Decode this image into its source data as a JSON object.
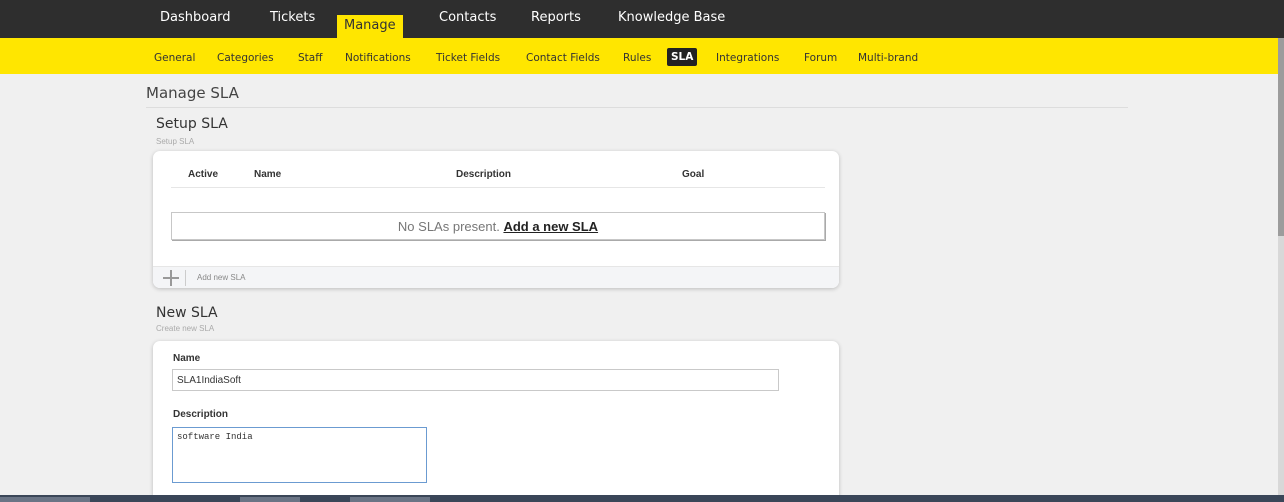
{
  "top_nav": {
    "items": [
      "Dashboard",
      "Tickets",
      "Manage",
      "Contacts",
      "Reports",
      "Knowledge Base"
    ],
    "active": "Manage"
  },
  "sub_nav": {
    "items": [
      "General",
      "Categories",
      "Staff",
      "Notifications",
      "Ticket Fields",
      "Contact Fields",
      "Rules",
      "SLA",
      "Integrations",
      "Forum",
      "Multi-brand"
    ],
    "active": "SLA"
  },
  "page": {
    "title": "Manage SLA"
  },
  "setup_sla": {
    "title": "Setup SLA",
    "subtitle": "Setup SLA",
    "columns": [
      "Active",
      "Name",
      "Description",
      "Goal"
    ],
    "empty_text": "No SLAs present.",
    "add_link": "Add a new SLA",
    "add_bar_label": "Add new SLA"
  },
  "new_sla": {
    "title": "New SLA",
    "subtitle": "Create new SLA",
    "name_label": "Name",
    "name_value": "SLA1IndiaSoft",
    "description_label": "Description",
    "description_value": "software India"
  },
  "colors": {
    "top_nav_bg": "#2e2e2e",
    "accent_yellow": "#ffe600",
    "page_bg": "#f0f0f0"
  }
}
